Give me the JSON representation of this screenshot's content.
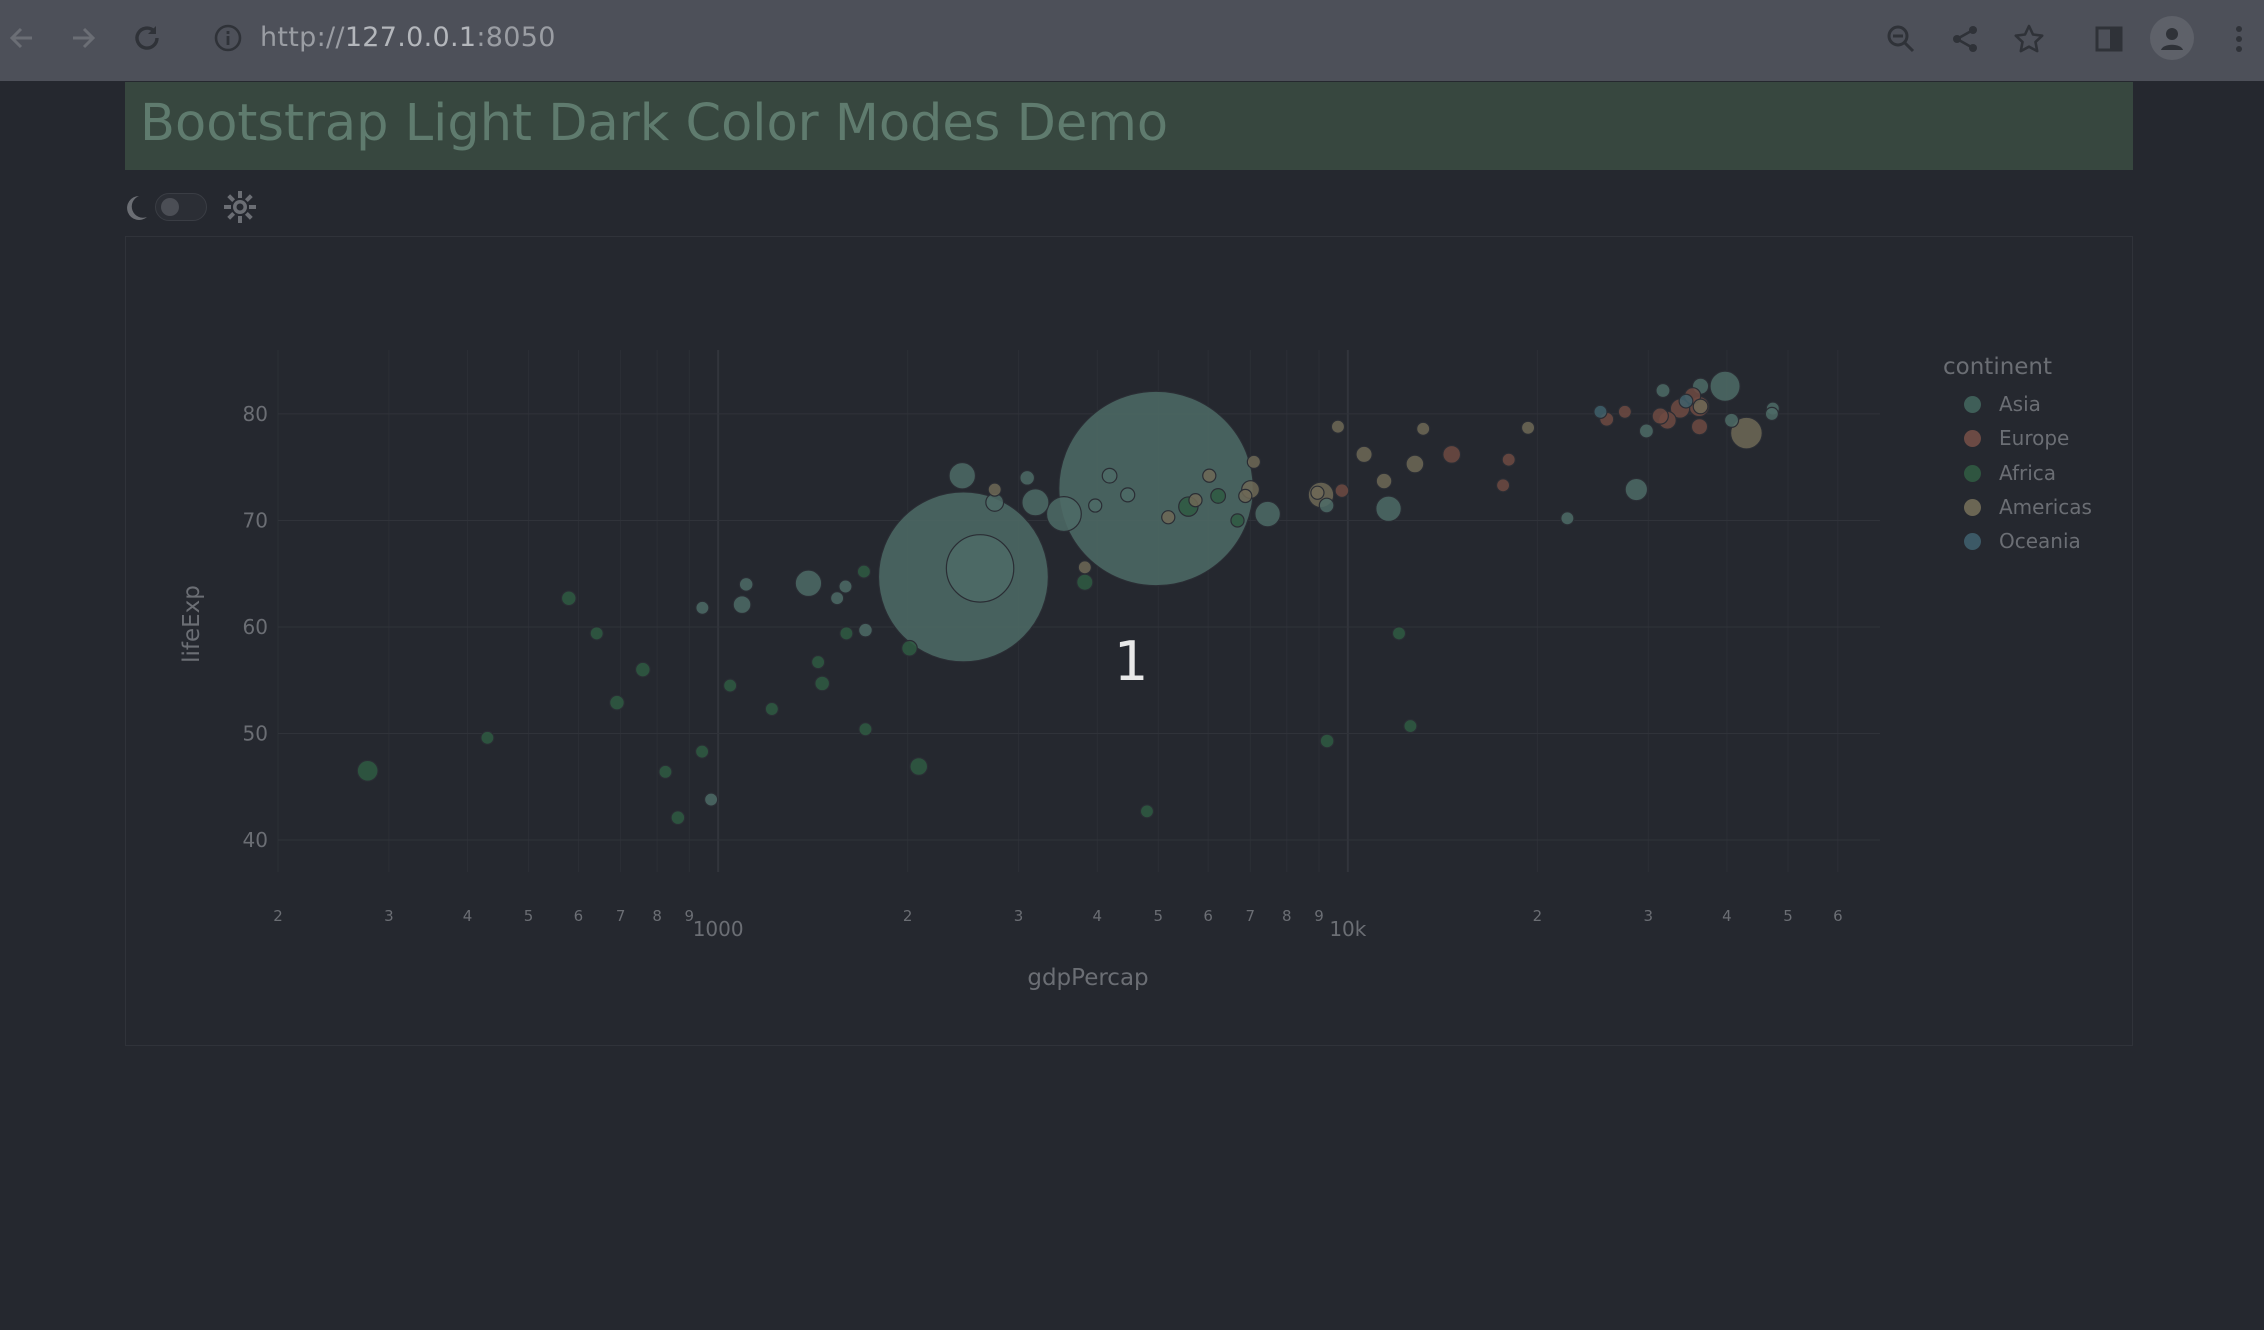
{
  "browser": {
    "url_prefix": "http://",
    "url_host": "127.0.0.1",
    "url_port": ":8050"
  },
  "header": {
    "title": "Bootstrap Light Dark Color Modes Demo"
  },
  "overlay": {
    "number": "1"
  },
  "legend": {
    "title": "continent",
    "items": [
      {
        "label": "Asia",
        "color": "#3f5e58"
      },
      {
        "label": "Europe",
        "color": "#6b4a44"
      },
      {
        "label": "Africa",
        "color": "#2f5540"
      },
      {
        "label": "Americas",
        "color": "#6b6654"
      },
      {
        "label": "Oceania",
        "color": "#3c5966"
      }
    ]
  },
  "colors": {
    "background": "#25282f",
    "header_bg": "#37473f",
    "Asia": "#4d6b66",
    "Europe": "#6e4a42",
    "Africa": "#2f5a42",
    "Americas": "#6e6856",
    "Oceania": "#40606b"
  },
  "chart_data": {
    "type": "scatter",
    "xlabel": "gdpPercap",
    "ylabel": "lifeExp",
    "x_scale": "log",
    "xlim": [
      200,
      70000
    ],
    "ylim": [
      37,
      86
    ],
    "x_major_ticks": [
      "1000",
      "10k"
    ],
    "y_ticks": [
      40,
      50,
      60,
      70,
      80
    ],
    "minor_tick_labels": [
      "2",
      "3",
      "4",
      "5",
      "6",
      "7",
      "8",
      "9",
      "1000",
      "2",
      "3",
      "4",
      "5",
      "6",
      "7",
      "8",
      "9",
      "10k",
      "2",
      "3",
      "4",
      "5",
      "6"
    ],
    "bubble_size_meaning": "pop",
    "series": [
      {
        "name": "Asia",
        "points": [
          [
            974.6,
            43.8,
            1.0
          ],
          [
            1391.3,
            64.1,
            5.3
          ],
          [
            1713.8,
            59.7,
            1.2
          ],
          [
            2452.2,
            64.7,
            39.0
          ],
          [
            3540.7,
            70.6,
            8.0
          ],
          [
            4959.1,
            73.0,
            45.0
          ],
          [
            2605.9,
            65.5,
            14.0
          ],
          [
            3190.5,
            71.7,
            5.5
          ],
          [
            4184.5,
            74.2,
            1.5
          ],
          [
            1091.4,
            62.1,
            2.5
          ],
          [
            2441.6,
            74.2,
            5.3
          ],
          [
            1593.1,
            63.8,
            1.0
          ],
          [
            11605.7,
            71.1,
            5.0
          ],
          [
            28718.3,
            72.9,
            4.0
          ],
          [
            39724.9,
            82.6,
            6.5
          ],
          [
            31656.1,
            82.2,
            1.3
          ],
          [
            47306.0,
            80.5,
            1.0
          ],
          [
            36319.2,
            82.6,
            2.0
          ],
          [
            7458.4,
            70.6,
            5.0
          ],
          [
            9253.9,
            71.4,
            1.5
          ],
          [
            3970.1,
            71.4,
            1.0
          ],
          [
            22316.2,
            70.2,
            1.0
          ],
          [
            40675.9,
            79.4,
            1.3
          ],
          [
            4471.1,
            72.4,
            1.3
          ],
          [
            3095.8,
            74.0,
            1.5
          ],
          [
            944.0,
            61.8,
            1.0
          ],
          [
            1545.0,
            62.7,
            1.0
          ],
          [
            2749.3,
            71.7,
            2.5
          ],
          [
            1108.0,
            64.0,
            1.2
          ],
          [
            47143.0,
            80.0,
            1.0
          ],
          [
            29796.0,
            78.4,
            1.3
          ]
        ]
      },
      {
        "name": "Europe",
        "points": [
          [
            31340.0,
            79.8,
            2.0
          ],
          [
            33692.6,
            80.5,
            3.0
          ],
          [
            32170.4,
            79.4,
            2.5
          ],
          [
            36126.5,
            80.7,
            3.3
          ],
          [
            25768.3,
            79.5,
            1.3
          ],
          [
            27538.4,
            80.2,
            1.0
          ],
          [
            36180.8,
            78.8,
            2.0
          ],
          [
            9786.5,
            72.8,
            1.2
          ],
          [
            18008.9,
            75.7,
            1.0
          ],
          [
            35278.4,
            81.7,
            2.0
          ],
          [
            17641.0,
            73.3,
            1.0
          ],
          [
            14619.0,
            76.2,
            2.5
          ]
        ]
      },
      {
        "name": "Africa",
        "points": [
          [
            6223.4,
            72.3,
            1.5
          ],
          [
            4797.2,
            42.7,
            1.0
          ],
          [
            1441.3,
            56.7,
            1.0
          ],
          [
            12569.9,
            50.7,
            1.0
          ],
          [
            1217.0,
            52.3,
            1.0
          ],
          [
            430.1,
            49.6,
            1.0
          ],
          [
            1713.8,
            50.4,
            1.0
          ],
          [
            2082.5,
            46.9,
            2.5
          ],
          [
            1704.1,
            65.2,
            1.0
          ],
          [
            5581.2,
            71.3,
            3.0
          ],
          [
            2013.0,
            58.0,
            1.8
          ],
          [
            641.4,
            59.4,
            1.0
          ],
          [
            690.8,
            52.9,
            1.5
          ],
          [
            6680.0,
            70.0,
            1.0
          ],
          [
            943.0,
            48.3,
            1.0
          ],
          [
            1463.0,
            54.7,
            1.5
          ],
          [
            863.1,
            42.1,
            1.2
          ],
          [
            1598.4,
            59.4,
            1.0
          ],
          [
            1044.8,
            54.5,
            1.0
          ],
          [
            579.2,
            62.7,
            1.5
          ],
          [
            824.7,
            46.4,
            1.0
          ],
          [
            12057.5,
            59.4,
            1.0
          ],
          [
            277.6,
            46.5,
            3.5
          ],
          [
            9269.7,
            49.3,
            1.2
          ],
          [
            3822.1,
            64.2,
            2.0
          ],
          [
            759.3,
            56.0,
            1.5
          ]
        ]
      },
      {
        "name": "Americas",
        "points": [
          [
            12779.4,
            75.3,
            2.5
          ],
          [
            3822.1,
            65.6,
            1.0
          ],
          [
            9065.8,
            72.4,
            5.0
          ],
          [
            36319.2,
            80.7,
            1.5
          ],
          [
            13171.6,
            78.6,
            1.0
          ],
          [
            7006.6,
            72.9,
            2.5
          ],
          [
            9645.1,
            78.8,
            1.0
          ],
          [
            7092.9,
            75.5,
            1.0
          ],
          [
            6025.4,
            74.2,
            1.0
          ],
          [
            5728.4,
            71.9,
            1.0
          ],
          [
            42951.7,
            78.2,
            7.0
          ],
          [
            10611.5,
            76.2,
            2.0
          ],
          [
            8948.1,
            72.6,
            1.0
          ],
          [
            11415.8,
            73.7,
            1.8
          ],
          [
            6873.3,
            72.3,
            1.0
          ],
          [
            19328.7,
            78.7,
            1.0
          ],
          [
            5186.1,
            70.3,
            1.0
          ],
          [
            2749.3,
            72.9,
            1.0
          ]
        ]
      },
      {
        "name": "Oceania",
        "points": [
          [
            34435.4,
            81.2,
            1.2
          ],
          [
            25185.0,
            80.2,
            1.0
          ]
        ]
      }
    ]
  }
}
